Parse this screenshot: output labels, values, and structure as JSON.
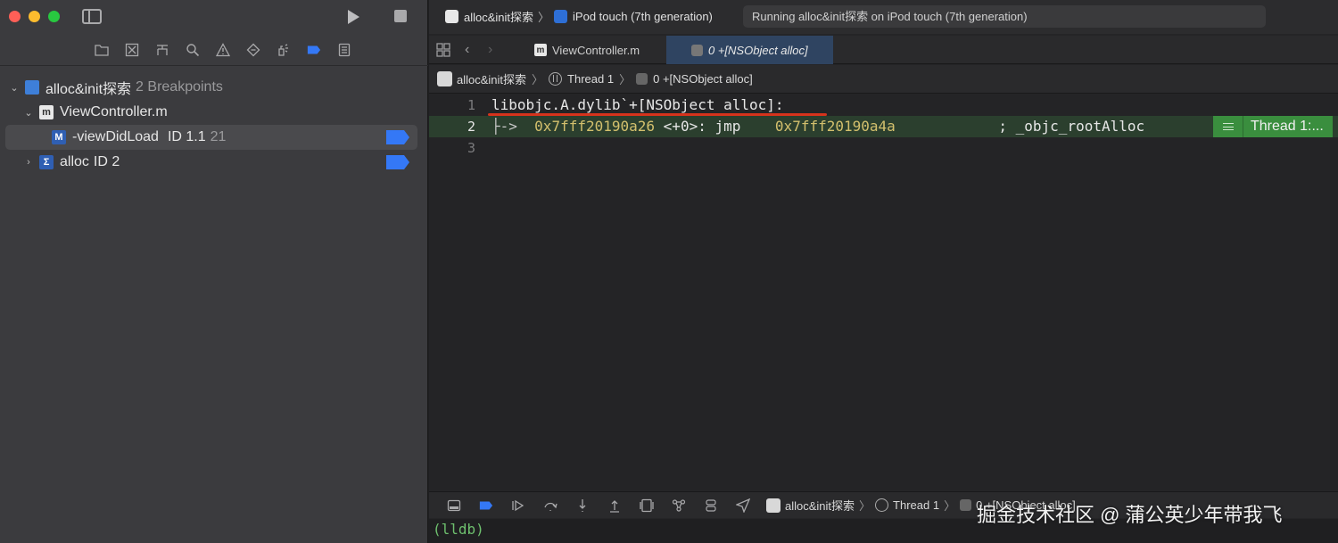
{
  "window": {
    "scheme": {
      "project": "alloc&init探索",
      "device": "iPod touch (7th generation)"
    },
    "status": "Running alloc&init探索 on iPod touch (7th generation)"
  },
  "navigator": {
    "project_row": {
      "name": "alloc&init探索",
      "secondary": "2 Breakpoints"
    },
    "file_row": {
      "name": "ViewController.m"
    },
    "breakpoint_1": {
      "name": "-viewDidLoad",
      "id": "ID 1.1",
      "line": "21"
    },
    "breakpoint_2": {
      "name": "alloc",
      "id": "ID 2"
    }
  },
  "tabs": [
    {
      "label": "ViewController.m",
      "active": false
    },
    {
      "label": "0 +[NSObject alloc]",
      "active": true
    }
  ],
  "jumpbar": {
    "project": "alloc&init探索",
    "thread": "Thread 1",
    "frame": "0 +[NSObject alloc]"
  },
  "code": {
    "lines": [
      {
        "num": "1",
        "text": "libobjc.A.dylib`+[NSObject alloc]:"
      },
      {
        "num": "2",
        "arrow": "├->",
        "addr1": "0x7fff20190a26",
        "offset": "<+0>:",
        "op": "jmp",
        "addr2": "0x7fff20190a4a",
        "comment": "; _objc_rootAlloc"
      },
      {
        "num": "3",
        "text": ""
      }
    ],
    "thread_marker": "Thread 1:..."
  },
  "debugbar": {
    "project": "alloc&init探索",
    "thread": "Thread 1",
    "frame": "0 +[NSObject alloc]"
  },
  "console": {
    "prompt": "(lldb)"
  },
  "watermark": "掘金技术社区 @ 蒲公英少年带我飞",
  "colors": {
    "breakpoint_blue": "#3478f6",
    "thread_green": "#3a8e3e",
    "annotation_red": "#d6331c"
  }
}
